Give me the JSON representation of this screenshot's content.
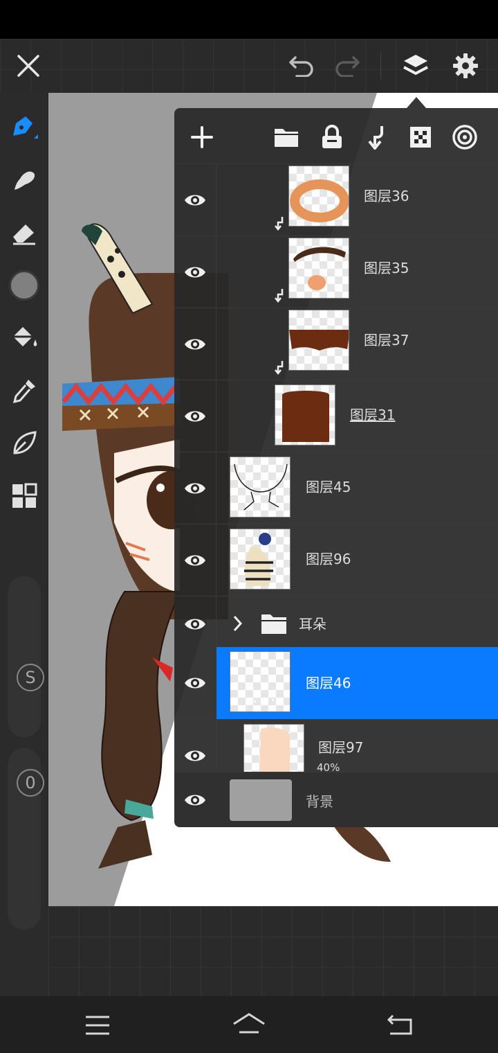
{
  "layers": [
    {
      "name": "图层36"
    },
    {
      "name": "图层35"
    },
    {
      "name": "图层37"
    },
    {
      "name": "图层31"
    },
    {
      "name": "图层45"
    },
    {
      "name": "图层96"
    },
    {
      "name": "耳朵"
    },
    {
      "name": "图层46"
    },
    {
      "name": "图层97",
      "opacity": "40%"
    },
    {
      "name": "背景"
    }
  ],
  "sliders": {
    "size_label": "S",
    "opacity_label": "0"
  },
  "colors": {
    "accent": "#0a7aff",
    "panel": "#282828",
    "current_color": "#808080"
  },
  "icons": [
    "close-icon",
    "undo-icon",
    "redo-icon",
    "layers-icon",
    "gear-icon",
    "pen-icon",
    "smudge-icon",
    "eraser-icon",
    "color-swatch-icon",
    "fill-bucket-icon",
    "eyedropper-icon",
    "leaf-icon",
    "grid-icon",
    "add-icon",
    "folder-icon",
    "lock-icon",
    "clip-icon",
    "transparency-icon",
    "blend-icon",
    "eye-icon",
    "chevron-right-icon",
    "menu-icon",
    "home-icon",
    "back-icon"
  ]
}
